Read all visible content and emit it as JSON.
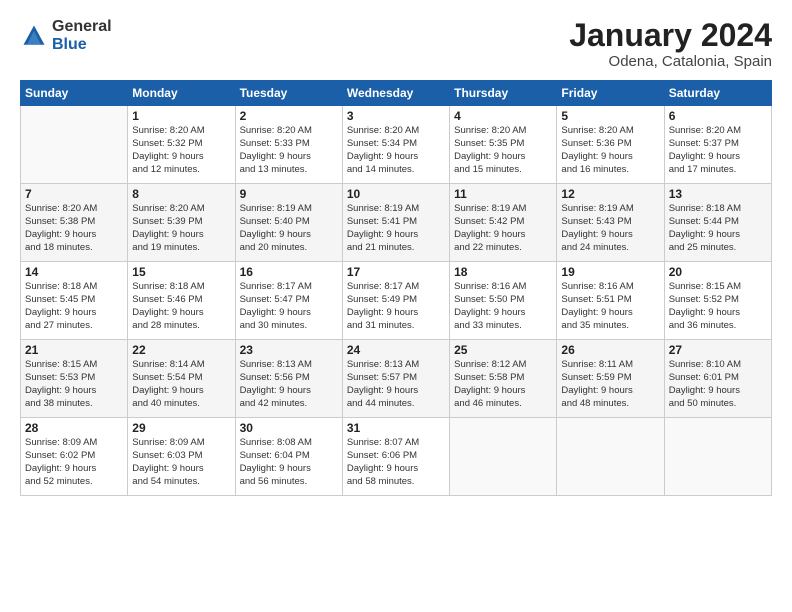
{
  "logo": {
    "general": "General",
    "blue": "Blue"
  },
  "title": "January 2024",
  "location": "Odena, Catalonia, Spain",
  "days_header": [
    "Sunday",
    "Monday",
    "Tuesday",
    "Wednesday",
    "Thursday",
    "Friday",
    "Saturday"
  ],
  "weeks": [
    [
      {
        "num": "",
        "content": ""
      },
      {
        "num": "1",
        "content": "Sunrise: 8:20 AM\nSunset: 5:32 PM\nDaylight: 9 hours\nand 12 minutes."
      },
      {
        "num": "2",
        "content": "Sunrise: 8:20 AM\nSunset: 5:33 PM\nDaylight: 9 hours\nand 13 minutes."
      },
      {
        "num": "3",
        "content": "Sunrise: 8:20 AM\nSunset: 5:34 PM\nDaylight: 9 hours\nand 14 minutes."
      },
      {
        "num": "4",
        "content": "Sunrise: 8:20 AM\nSunset: 5:35 PM\nDaylight: 9 hours\nand 15 minutes."
      },
      {
        "num": "5",
        "content": "Sunrise: 8:20 AM\nSunset: 5:36 PM\nDaylight: 9 hours\nand 16 minutes."
      },
      {
        "num": "6",
        "content": "Sunrise: 8:20 AM\nSunset: 5:37 PM\nDaylight: 9 hours\nand 17 minutes."
      }
    ],
    [
      {
        "num": "7",
        "content": "Sunrise: 8:20 AM\nSunset: 5:38 PM\nDaylight: 9 hours\nand 18 minutes."
      },
      {
        "num": "8",
        "content": "Sunrise: 8:20 AM\nSunset: 5:39 PM\nDaylight: 9 hours\nand 19 minutes."
      },
      {
        "num": "9",
        "content": "Sunrise: 8:19 AM\nSunset: 5:40 PM\nDaylight: 9 hours\nand 20 minutes."
      },
      {
        "num": "10",
        "content": "Sunrise: 8:19 AM\nSunset: 5:41 PM\nDaylight: 9 hours\nand 21 minutes."
      },
      {
        "num": "11",
        "content": "Sunrise: 8:19 AM\nSunset: 5:42 PM\nDaylight: 9 hours\nand 22 minutes."
      },
      {
        "num": "12",
        "content": "Sunrise: 8:19 AM\nSunset: 5:43 PM\nDaylight: 9 hours\nand 24 minutes."
      },
      {
        "num": "13",
        "content": "Sunrise: 8:18 AM\nSunset: 5:44 PM\nDaylight: 9 hours\nand 25 minutes."
      }
    ],
    [
      {
        "num": "14",
        "content": "Sunrise: 8:18 AM\nSunset: 5:45 PM\nDaylight: 9 hours\nand 27 minutes."
      },
      {
        "num": "15",
        "content": "Sunrise: 8:18 AM\nSunset: 5:46 PM\nDaylight: 9 hours\nand 28 minutes."
      },
      {
        "num": "16",
        "content": "Sunrise: 8:17 AM\nSunset: 5:47 PM\nDaylight: 9 hours\nand 30 minutes."
      },
      {
        "num": "17",
        "content": "Sunrise: 8:17 AM\nSunset: 5:49 PM\nDaylight: 9 hours\nand 31 minutes."
      },
      {
        "num": "18",
        "content": "Sunrise: 8:16 AM\nSunset: 5:50 PM\nDaylight: 9 hours\nand 33 minutes."
      },
      {
        "num": "19",
        "content": "Sunrise: 8:16 AM\nSunset: 5:51 PM\nDaylight: 9 hours\nand 35 minutes."
      },
      {
        "num": "20",
        "content": "Sunrise: 8:15 AM\nSunset: 5:52 PM\nDaylight: 9 hours\nand 36 minutes."
      }
    ],
    [
      {
        "num": "21",
        "content": "Sunrise: 8:15 AM\nSunset: 5:53 PM\nDaylight: 9 hours\nand 38 minutes."
      },
      {
        "num": "22",
        "content": "Sunrise: 8:14 AM\nSunset: 5:54 PM\nDaylight: 9 hours\nand 40 minutes."
      },
      {
        "num": "23",
        "content": "Sunrise: 8:13 AM\nSunset: 5:56 PM\nDaylight: 9 hours\nand 42 minutes."
      },
      {
        "num": "24",
        "content": "Sunrise: 8:13 AM\nSunset: 5:57 PM\nDaylight: 9 hours\nand 44 minutes."
      },
      {
        "num": "25",
        "content": "Sunrise: 8:12 AM\nSunset: 5:58 PM\nDaylight: 9 hours\nand 46 minutes."
      },
      {
        "num": "26",
        "content": "Sunrise: 8:11 AM\nSunset: 5:59 PM\nDaylight: 9 hours\nand 48 minutes."
      },
      {
        "num": "27",
        "content": "Sunrise: 8:10 AM\nSunset: 6:01 PM\nDaylight: 9 hours\nand 50 minutes."
      }
    ],
    [
      {
        "num": "28",
        "content": "Sunrise: 8:09 AM\nSunset: 6:02 PM\nDaylight: 9 hours\nand 52 minutes."
      },
      {
        "num": "29",
        "content": "Sunrise: 8:09 AM\nSunset: 6:03 PM\nDaylight: 9 hours\nand 54 minutes."
      },
      {
        "num": "30",
        "content": "Sunrise: 8:08 AM\nSunset: 6:04 PM\nDaylight: 9 hours\nand 56 minutes."
      },
      {
        "num": "31",
        "content": "Sunrise: 8:07 AM\nSunset: 6:06 PM\nDaylight: 9 hours\nand 58 minutes."
      },
      {
        "num": "",
        "content": ""
      },
      {
        "num": "",
        "content": ""
      },
      {
        "num": "",
        "content": ""
      }
    ]
  ]
}
